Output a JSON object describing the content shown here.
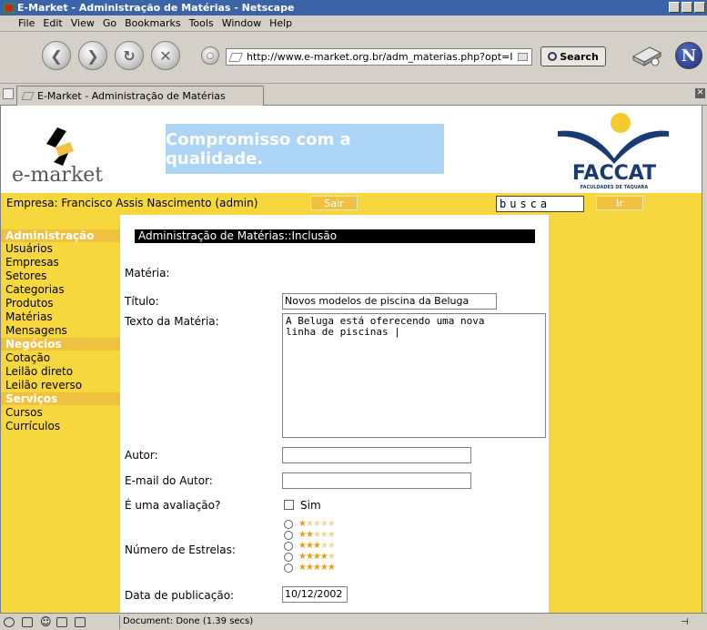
{
  "window": {
    "title": "E-Market - Administração de Matérias - Netscape"
  },
  "menu": [
    "File",
    "Edit",
    "View",
    "Go",
    "Bookmarks",
    "Tools",
    "Window",
    "Help"
  ],
  "toolbar": {
    "url": "http://www.e-market.org.br/adm_materias.php?opt=I",
    "search_label": "Search"
  },
  "tab": {
    "label": "E-Market - Administração de Matérias"
  },
  "header": {
    "logo_text": "e-market",
    "banner": "Compromisso com a qualidade.",
    "partner_logo": "FACCAT",
    "partner_sub": "FACULDADES DE TAQUARA"
  },
  "topbar": {
    "company": "Empresa: Francisco Assis Nascimento (admin)",
    "logout_label": "Sair",
    "search_value": "busca",
    "go_label": "Ir"
  },
  "sidebar": {
    "sections": [
      {
        "title": "Administração",
        "items": [
          "Usuários",
          "Empresas",
          "Setores",
          "Categorias",
          "Produtos",
          "Matérias",
          "Mensagens"
        ]
      },
      {
        "title": "Negócios",
        "items": [
          "Cotação",
          "Leilão direto",
          "Leilão reverso"
        ]
      },
      {
        "title": "Serviços",
        "items": [
          "Cursos",
          "Currículos"
        ]
      }
    ]
  },
  "form": {
    "section_title": "Administração de Matérias::Inclusão",
    "materia_label": "Matéria:",
    "titulo_label": "Título:",
    "titulo_value": "Novos modelos de piscina da Beluga",
    "texto_label": "Texto da Matéria:",
    "texto_value": "A Beluga está oferecendo uma nova\nlinha de piscinas |",
    "autor_label": "Autor:",
    "autor_value": "",
    "email_label": "E-mail do Autor:",
    "email_value": "",
    "avaliacao_label": "É uma avaliação?",
    "avaliacao_option": "Sim",
    "estrelas_label": "Número de Estrelas:",
    "star_options": [
      1,
      2,
      3,
      4,
      5
    ],
    "data_label": "Data de publicação:",
    "data_value": "10/12/2002"
  },
  "status": {
    "text": "Document: Done (1.39 secs)"
  },
  "colors": {
    "title_bar": "#3a63a8",
    "yellow": "#f6d73e",
    "dark_yellow": "#f0c040",
    "banner": "#acd4f4",
    "faccat_blue": "#1a3a74"
  }
}
